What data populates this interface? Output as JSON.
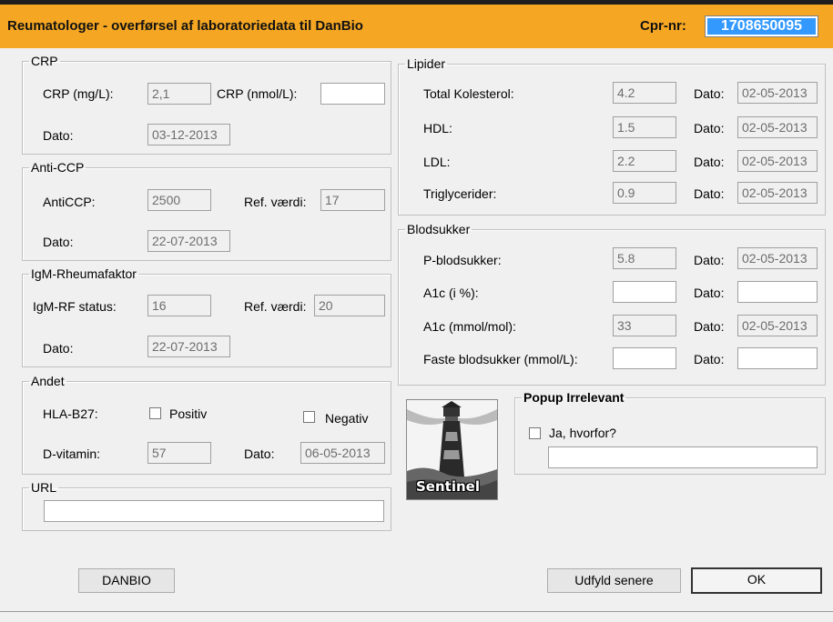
{
  "header": {
    "title": "Reumatologer - overførsel af laboratoriedata til DanBio",
    "cpr_label": "Cpr-nr:",
    "cpr_value": "1708650095"
  },
  "crp": {
    "legend": "CRP",
    "crp_mgl_label": "CRP (mg/L):",
    "crp_mgl_value": "2,1",
    "crp_nmol_label": "CRP (nmol/L):",
    "crp_nmol_value": "",
    "date_label": "Dato:",
    "date_value": "03-12-2013"
  },
  "anticcp": {
    "legend": "Anti-CCP",
    "label": "AntiCCP:",
    "value": "2500",
    "ref_label": "Ref. værdi:",
    "ref_value": "17",
    "date_label": "Dato:",
    "date_value": "22-07-2013"
  },
  "igm": {
    "legend": "IgM-Rheumafaktor",
    "label": "IgM-RF status:",
    "value": "16",
    "ref_label": "Ref. værdi:",
    "ref_value": "20",
    "date_label": "Dato:",
    "date_value": "22-07-2013"
  },
  "andet": {
    "legend": "Andet",
    "hla_label": "HLA-B27:",
    "positiv_label": "Positiv",
    "negativ_label": "Negativ",
    "dvit_label": "D-vitamin:",
    "dvit_value": "57",
    "date_label": "Dato:",
    "date_value": "06-05-2013"
  },
  "url": {
    "legend": "URL",
    "value": ""
  },
  "lipider": {
    "legend": "Lipider",
    "rows": [
      {
        "label": "Total Kolesterol:",
        "value": "4.2",
        "date_label": "Dato:",
        "date": "02-05-2013"
      },
      {
        "label": "HDL:",
        "value": "1.5",
        "date_label": "Dato:",
        "date": "02-05-2013"
      },
      {
        "label": "LDL:",
        "value": "2.2",
        "date_label": "Dato:",
        "date": "02-05-2013"
      },
      {
        "label": "Triglycerider:",
        "value": "0.9",
        "date_label": "Dato:",
        "date": "02-05-2013"
      }
    ]
  },
  "blodsukker": {
    "legend": "Blodsukker",
    "rows": [
      {
        "label": "P-blodsukker:",
        "value": "5.8",
        "date_label": "Dato:",
        "date": "02-05-2013"
      },
      {
        "label": "A1c (i %):",
        "value": "",
        "date_label": "Dato:",
        "date": ""
      },
      {
        "label": "A1c (mmol/mol):",
        "value": "33",
        "date_label": "Dato:",
        "date": "02-05-2013"
      },
      {
        "label": "Faste blodsukker (mmol/L):",
        "value": "",
        "date_label": "Dato:",
        "date": ""
      }
    ]
  },
  "logo": {
    "text": "Sentinel",
    "icon": "lighthouse-icon"
  },
  "popup": {
    "legend": "Popup Irrelevant",
    "checkbox_label": "Ja, hvorfor?",
    "reason_value": ""
  },
  "buttons": {
    "danbio": "DANBIO",
    "later": "Udfyld senere",
    "ok": "OK"
  },
  "colors": {
    "header_bg": "#f5a622",
    "selection": "#3399ff"
  }
}
